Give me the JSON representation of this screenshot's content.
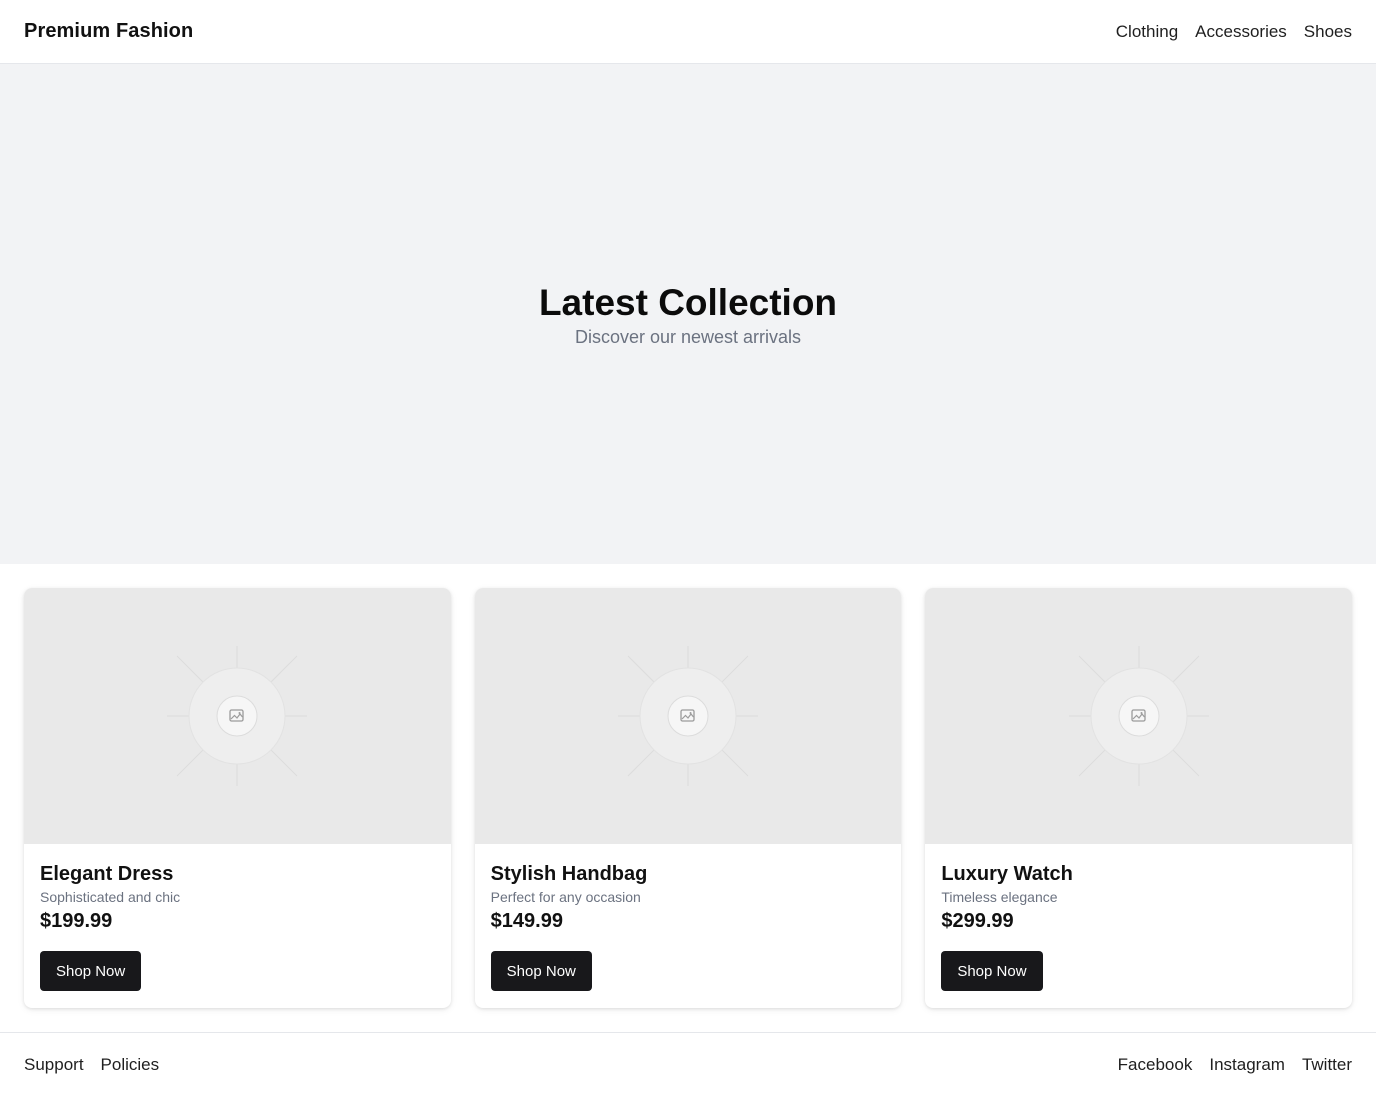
{
  "header": {
    "brand": "Premium Fashion",
    "nav": [
      "Clothing",
      "Accessories",
      "Shoes"
    ]
  },
  "hero": {
    "title": "Latest Collection",
    "subtitle": "Discover our newest arrivals"
  },
  "products": [
    {
      "name": "Elegant Dress",
      "description": "Sophisticated and chic",
      "price": "$199.99",
      "button": "Shop Now",
      "image_icon": "image-placeholder-icon"
    },
    {
      "name": "Stylish Handbag",
      "description": "Perfect for any occasion",
      "price": "$149.99",
      "button": "Shop Now",
      "image_icon": "image-placeholder-icon"
    },
    {
      "name": "Luxury Watch",
      "description": "Timeless elegance",
      "price": "$299.99",
      "button": "Shop Now",
      "image_icon": "image-placeholder-icon"
    }
  ],
  "footer": {
    "left_links": [
      "Support",
      "Policies"
    ],
    "right_links": [
      "Facebook",
      "Instagram",
      "Twitter"
    ]
  },
  "colors": {
    "button_bg": "#18181b",
    "hero_bg": "#f2f3f5",
    "muted_text": "#6b7280",
    "placeholder_bg": "#e9e9e9"
  }
}
